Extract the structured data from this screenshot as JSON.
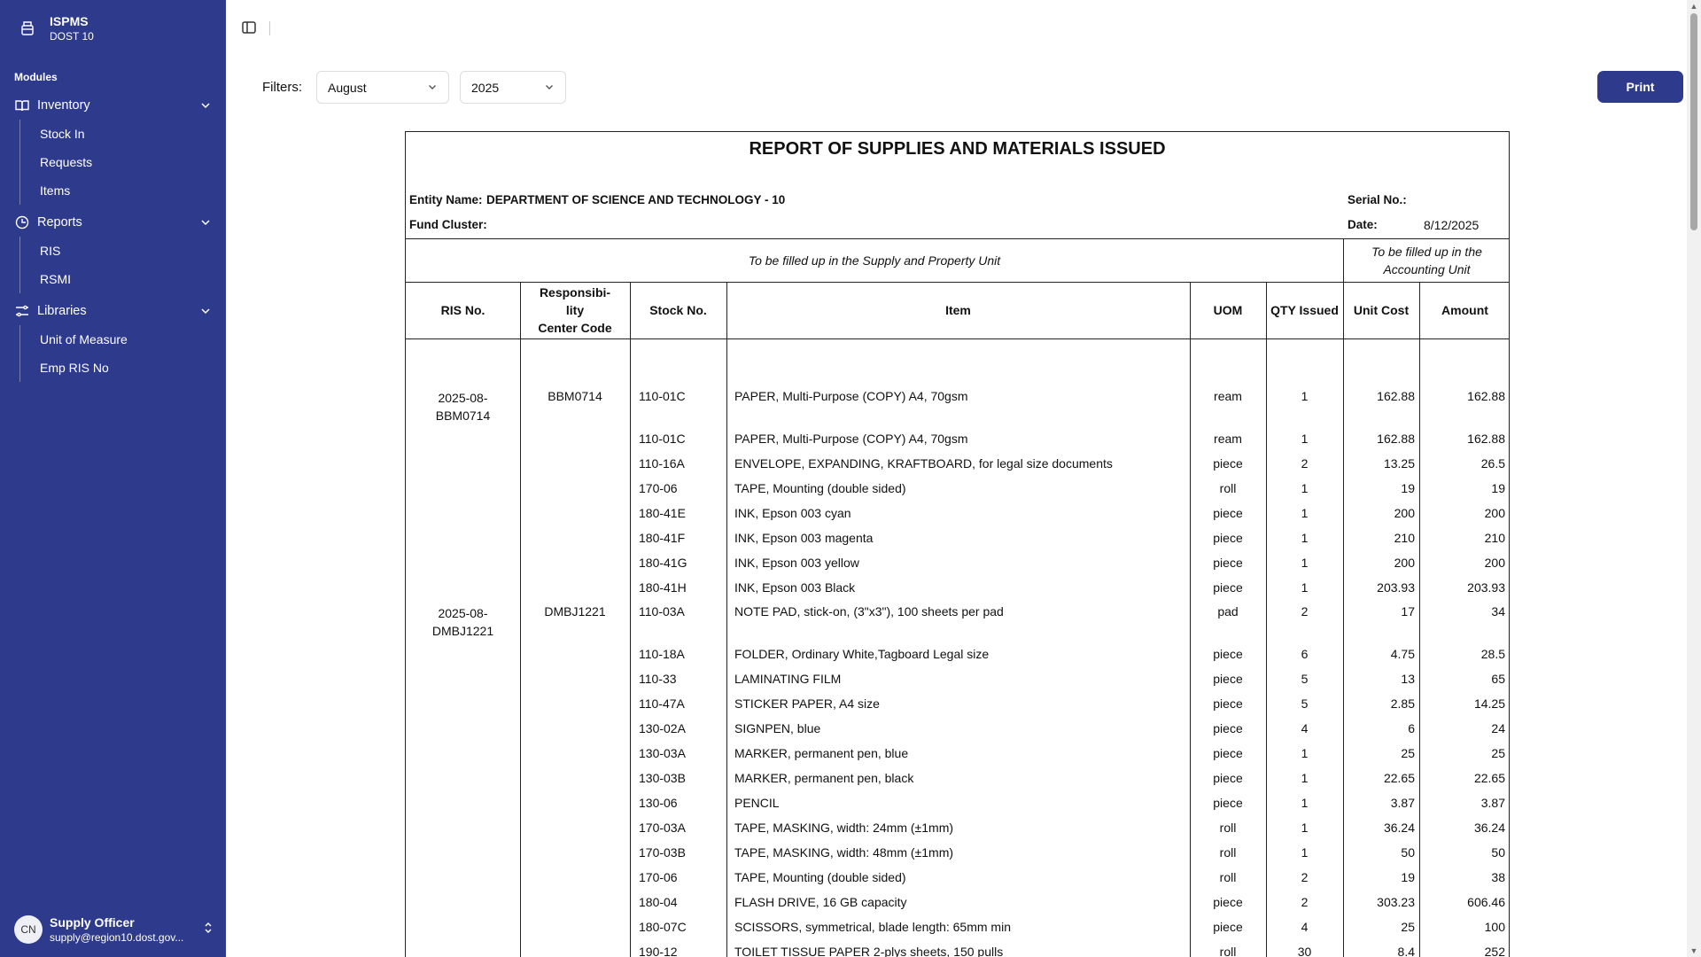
{
  "brand": {
    "title": "ISPMS",
    "subtitle": "DOST 10"
  },
  "sidebar": {
    "modules_label": "Modules",
    "groups": [
      {
        "label": "Inventory",
        "icon": "book-open-icon",
        "items": [
          "Stock In",
          "Requests",
          "Items"
        ]
      },
      {
        "label": "Reports",
        "icon": "clock-icon",
        "items": [
          "RIS",
          "RSMI"
        ]
      },
      {
        "label": "Libraries",
        "icon": "sliders-icon",
        "items": [
          "Unit of Measure",
          "Emp RIS No"
        ]
      }
    ],
    "user": {
      "initials": "CN",
      "name": "Supply Officer",
      "email": "supply@region10.dost.gov..."
    }
  },
  "filters": {
    "label": "Filters:",
    "month": "August",
    "year": "2025",
    "print_label": "Print"
  },
  "report": {
    "title": "REPORT OF SUPPLIES AND MATERIALS ISSUED",
    "entity_label": "Entity Name:",
    "entity_value": "DEPARTMENT OF SCIENCE AND TECHNOLOGY - 10",
    "fund_label": "Fund Cluster:",
    "serial_label": "Serial No.:",
    "date_label": "Date:",
    "date_value": "8/12/2025",
    "note_supply": "To be filled up in the Supply and Property Unit",
    "note_accounting_1": "To be filled up in the",
    "note_accounting_2": "Accounting Unit",
    "headers": {
      "ris": "RIS No.",
      "rcc_1": "Responsibi-",
      "rcc_2": "lity",
      "rcc_3": "Center Code",
      "stock": "Stock No.",
      "item": "Item",
      "uom": "UOM",
      "qty": "QTY Issued",
      "unit_cost": "Unit Cost",
      "amount": "Amount"
    },
    "groups": [
      {
        "ris_1": "2025-08-",
        "ris_2": "BBM0714",
        "rcc": "BBM0714"
      },
      {
        "ris_1": "2025-08-",
        "ris_2": "DMBJ1221",
        "rcc": "DMBJ1221"
      }
    ],
    "rows": [
      {
        "stock": "110-01C",
        "item": "PAPER, Multi-Purpose (COPY) A4, 70gsm",
        "uom": "ream",
        "qty": "1",
        "unit_cost": "162.88",
        "amount": "162.88"
      },
      {
        "stock": "110-01C",
        "item": "PAPER, Multi-Purpose (COPY) A4, 70gsm",
        "uom": "ream",
        "qty": "1",
        "unit_cost": "162.88",
        "amount": "162.88"
      },
      {
        "stock": "110-16A",
        "item": "ENVELOPE, EXPANDING, KRAFTBOARD, for legal size documents",
        "uom": "piece",
        "qty": "2",
        "unit_cost": "13.25",
        "amount": "26.5"
      },
      {
        "stock": "170-06",
        "item": "TAPE, Mounting (double sided)",
        "uom": "roll",
        "qty": "1",
        "unit_cost": "19",
        "amount": "19"
      },
      {
        "stock": "180-41E",
        "item": "INK, Epson 003 cyan",
        "uom": "piece",
        "qty": "1",
        "unit_cost": "200",
        "amount": "200"
      },
      {
        "stock": "180-41F",
        "item": "INK, Epson 003 magenta",
        "uom": "piece",
        "qty": "1",
        "unit_cost": "210",
        "amount": "210"
      },
      {
        "stock": "180-41G",
        "item": "INK, Epson 003 yellow",
        "uom": "piece",
        "qty": "1",
        "unit_cost": "200",
        "amount": "200"
      },
      {
        "stock": "180-41H",
        "item": "INK, Epson 003 Black",
        "uom": "piece",
        "qty": "1",
        "unit_cost": "203.93",
        "amount": "203.93"
      },
      {
        "stock": "110-03A",
        "item": "NOTE PAD, stick-on, (3\"x3\"), 100 sheets per pad",
        "uom": "pad",
        "qty": "2",
        "unit_cost": "17",
        "amount": "34"
      },
      {
        "stock": "110-18A",
        "item": "FOLDER, Ordinary White,Tagboard Legal size",
        "uom": "piece",
        "qty": "6",
        "unit_cost": "4.75",
        "amount": "28.5"
      },
      {
        "stock": "110-33",
        "item": "LAMINATING FILM",
        "uom": "piece",
        "qty": "5",
        "unit_cost": "13",
        "amount": "65"
      },
      {
        "stock": "110-47A",
        "item": "STICKER PAPER, A4 size",
        "uom": "piece",
        "qty": "5",
        "unit_cost": "2.85",
        "amount": "14.25"
      },
      {
        "stock": "130-02A",
        "item": "SIGNPEN, blue",
        "uom": "piece",
        "qty": "4",
        "unit_cost": "6",
        "amount": "24"
      },
      {
        "stock": "130-03A",
        "item": "MARKER, permanent pen, blue",
        "uom": "piece",
        "qty": "1",
        "unit_cost": "25",
        "amount": "25"
      },
      {
        "stock": "130-03B",
        "item": "MARKER, permanent pen, black",
        "uom": "piece",
        "qty": "1",
        "unit_cost": "22.65",
        "amount": "22.65"
      },
      {
        "stock": "130-06",
        "item": "PENCIL",
        "uom": "piece",
        "qty": "1",
        "unit_cost": "3.87",
        "amount": "3.87"
      },
      {
        "stock": "170-03A",
        "item": "TAPE, MASKING, width: 24mm (±1mm)",
        "uom": "roll",
        "qty": "1",
        "unit_cost": "36.24",
        "amount": "36.24"
      },
      {
        "stock": "170-03B",
        "item": "TAPE, MASKING, width: 48mm (±1mm)",
        "uom": "roll",
        "qty": "1",
        "unit_cost": "50",
        "amount": "50"
      },
      {
        "stock": "170-06",
        "item": "TAPE, Mounting (double sided)",
        "uom": "roll",
        "qty": "2",
        "unit_cost": "19",
        "amount": "38"
      },
      {
        "stock": "180-04",
        "item": "FLASH DRIVE, 16 GB capacity",
        "uom": "piece",
        "qty": "2",
        "unit_cost": "303.23",
        "amount": "606.46"
      },
      {
        "stock": "180-07C",
        "item": "SCISSORS, symmetrical, blade length: 65mm min",
        "uom": "piece",
        "qty": "4",
        "unit_cost": "25",
        "amount": "100"
      },
      {
        "stock": "190-12",
        "item": "TOILET TISSUE PAPER 2-plys sheets, 150 pulls",
        "uom": "roll",
        "qty": "30",
        "unit_cost": "8.4",
        "amount": "252"
      }
    ]
  }
}
